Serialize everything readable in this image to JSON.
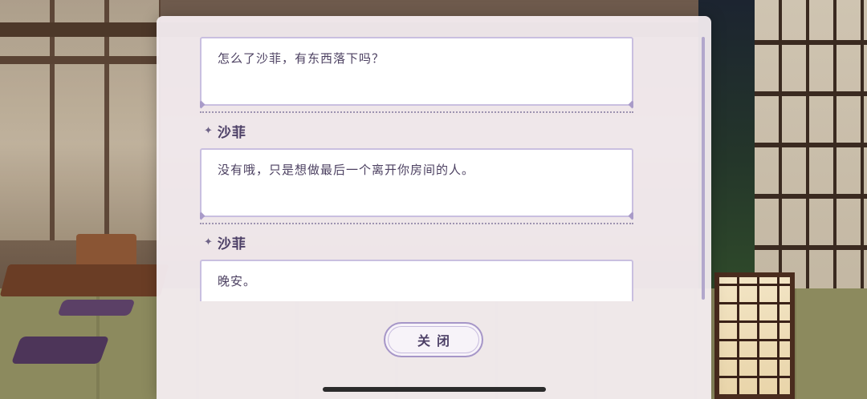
{
  "dialog_log": {
    "entries": [
      {
        "speaker": "",
        "text": "怎么了沙菲，有东西落下吗？"
      },
      {
        "speaker": "沙菲",
        "text": "没有哦，只是想做最后一个离开你房间的人。"
      },
      {
        "speaker": "沙菲",
        "text": "晚安。"
      }
    ]
  },
  "close_button": {
    "label": "关闭"
  },
  "icons": {
    "speaker_marker": "sparkle-icon"
  },
  "colors": {
    "panel": "#f5eef2",
    "text": "#4c4061",
    "accent": "#a696c8"
  }
}
